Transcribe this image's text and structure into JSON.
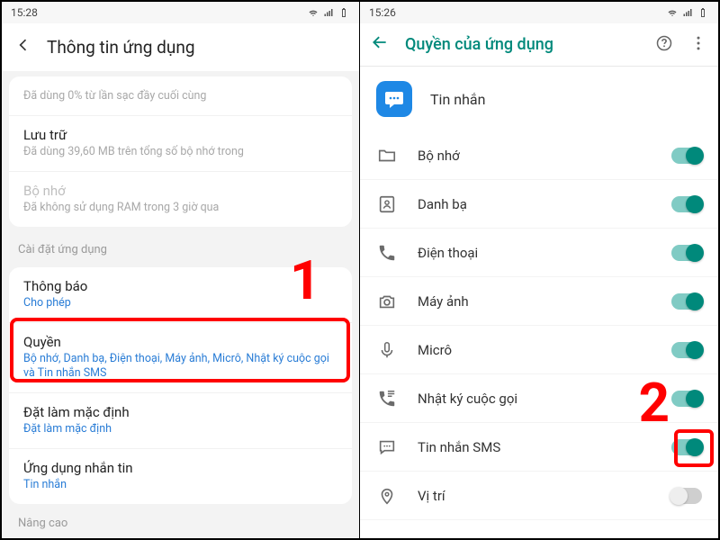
{
  "left": {
    "statusbar": {
      "time": "15:28"
    },
    "header": {
      "title": "Thông tin ứng dụng"
    },
    "battery_line": "Đã dùng 0% từ lần sạc đầy cuối cùng",
    "storage": {
      "title": "Lưu trữ",
      "sub": "Đã dùng 39,60 MB trên tổng số bộ nhớ trong"
    },
    "memory": {
      "title": "Bộ nhớ",
      "sub": "Đã không sử dụng RAM trong 3 giờ qua"
    },
    "section_settings": "Cài đặt ứng dụng",
    "notifications": {
      "title": "Thông báo",
      "sub": "Cho phép"
    },
    "permissions": {
      "title": "Quyền",
      "sub": "Bộ nhớ, Danh bạ, Điện thoại, Máy ảnh, Micrô, Nhật ký cuộc gọi và Tin nhắn SMS"
    },
    "default": {
      "title": "Đặt làm mặc định",
      "sub": "Đặt làm mặc định"
    },
    "messaging": {
      "title": "Ứng dụng nhắn tin",
      "sub": "Tin nhắn"
    },
    "advanced": "Nâng cao",
    "marker": "1"
  },
  "right": {
    "statusbar": {
      "time": "15:26"
    },
    "header": {
      "title": "Quyền của ứng dụng"
    },
    "app_name": "Tin nhắn",
    "permissions": [
      {
        "icon": "folder-icon",
        "label": "Bộ nhớ",
        "on": true
      },
      {
        "icon": "contacts-icon",
        "label": "Danh bạ",
        "on": true
      },
      {
        "icon": "phone-icon",
        "label": "Điện thoại",
        "on": true
      },
      {
        "icon": "camera-icon",
        "label": "Máy ảnh",
        "on": true
      },
      {
        "icon": "mic-icon",
        "label": "Micrô",
        "on": true
      },
      {
        "icon": "calllog-icon",
        "label": "Nhật ký cuộc gọi",
        "on": true
      },
      {
        "icon": "sms-icon",
        "label": "Tin nhắn SMS",
        "on": true
      },
      {
        "icon": "location-icon",
        "label": "Vị trí",
        "on": false
      }
    ],
    "marker": "2"
  }
}
